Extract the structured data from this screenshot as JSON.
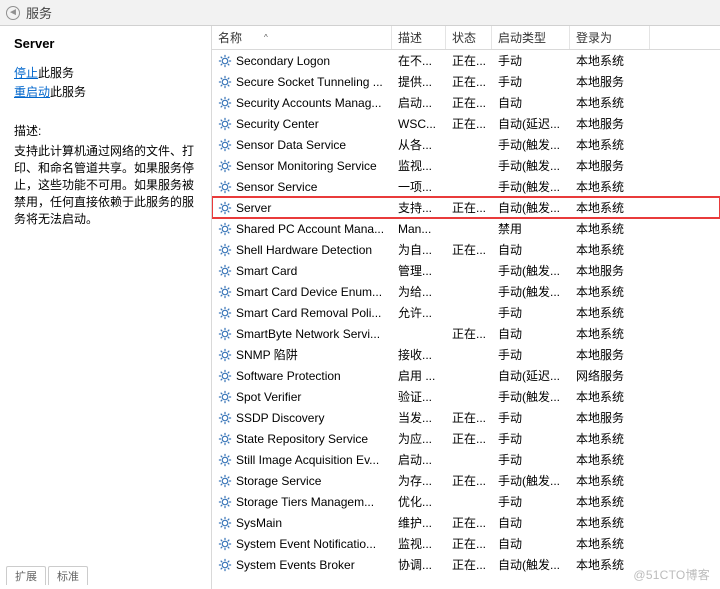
{
  "header": {
    "title": "服务"
  },
  "left": {
    "title": "Server",
    "stop_label": "停止",
    "stop_after": "此服务",
    "restart_label": "重启动",
    "restart_after": "此服务",
    "desc_label": "描述:",
    "desc_text": "支持此计算机通过网络的文件、打印、和命名管道共享。如果服务停止，这些功能不可用。如果服务被禁用，任何直接依赖于此服务的服务将无法启动。"
  },
  "columns": {
    "name": "名称",
    "desc": "描述",
    "state": "状态",
    "startup": "启动类型",
    "logon": "登录为"
  },
  "services": [
    {
      "name": "Secondary Logon",
      "desc": "在不...",
      "state": "正在...",
      "startup": "手动",
      "logon": "本地系统"
    },
    {
      "name": "Secure Socket Tunneling ...",
      "desc": "提供...",
      "state": "正在...",
      "startup": "手动",
      "logon": "本地服务"
    },
    {
      "name": "Security Accounts Manag...",
      "desc": "启动...",
      "state": "正在...",
      "startup": "自动",
      "logon": "本地系统"
    },
    {
      "name": "Security Center",
      "desc": "WSC...",
      "state": "正在...",
      "startup": "自动(延迟...",
      "logon": "本地服务"
    },
    {
      "name": "Sensor Data Service",
      "desc": "从各...",
      "state": "",
      "startup": "手动(触发...",
      "logon": "本地系统"
    },
    {
      "name": "Sensor Monitoring Service",
      "desc": "监视...",
      "state": "",
      "startup": "手动(触发...",
      "logon": "本地服务"
    },
    {
      "name": "Sensor Service",
      "desc": "一项...",
      "state": "",
      "startup": "手动(触发...",
      "logon": "本地系统"
    },
    {
      "name": "Server",
      "desc": "支持...",
      "state": "正在...",
      "startup": "自动(触发...",
      "logon": "本地系统"
    },
    {
      "name": "Shared PC Account Mana...",
      "desc": "Man...",
      "state": "",
      "startup": "禁用",
      "logon": "本地系统"
    },
    {
      "name": "Shell Hardware Detection",
      "desc": "为自...",
      "state": "正在...",
      "startup": "自动",
      "logon": "本地系统"
    },
    {
      "name": "Smart Card",
      "desc": "管理...",
      "state": "",
      "startup": "手动(触发...",
      "logon": "本地服务"
    },
    {
      "name": "Smart Card Device Enum...",
      "desc": "为给...",
      "state": "",
      "startup": "手动(触发...",
      "logon": "本地系统"
    },
    {
      "name": "Smart Card Removal Poli...",
      "desc": "允许...",
      "state": "",
      "startup": "手动",
      "logon": "本地系统"
    },
    {
      "name": "SmartByte Network Servi...",
      "desc": "",
      "state": "正在...",
      "startup": "自动",
      "logon": "本地系统"
    },
    {
      "name": "SNMP 陷阱",
      "desc": "接收...",
      "state": "",
      "startup": "手动",
      "logon": "本地服务"
    },
    {
      "name": "Software Protection",
      "desc": "启用 ...",
      "state": "",
      "startup": "自动(延迟...",
      "logon": "网络服务"
    },
    {
      "name": "Spot Verifier",
      "desc": "验证...",
      "state": "",
      "startup": "手动(触发...",
      "logon": "本地系统"
    },
    {
      "name": "SSDP Discovery",
      "desc": "当发...",
      "state": "正在...",
      "startup": "手动",
      "logon": "本地服务"
    },
    {
      "name": "State Repository Service",
      "desc": "为应...",
      "state": "正在...",
      "startup": "手动",
      "logon": "本地系统"
    },
    {
      "name": "Still Image Acquisition Ev...",
      "desc": "启动...",
      "state": "",
      "startup": "手动",
      "logon": "本地系统"
    },
    {
      "name": "Storage Service",
      "desc": "为存...",
      "state": "正在...",
      "startup": "手动(触发...",
      "logon": "本地系统"
    },
    {
      "name": "Storage Tiers Managem...",
      "desc": "优化...",
      "state": "",
      "startup": "手动",
      "logon": "本地系统"
    },
    {
      "name": "SysMain",
      "desc": "维护...",
      "state": "正在...",
      "startup": "自动",
      "logon": "本地系统"
    },
    {
      "name": "System Event Notificatio...",
      "desc": "监视...",
      "state": "正在...",
      "startup": "自动",
      "logon": "本地系统"
    },
    {
      "name": "System Events Broker",
      "desc": "协调...",
      "state": "正在...",
      "startup": "自动(触发...",
      "logon": "本地系统"
    }
  ],
  "highlight_index": 7,
  "watermark": "@51CTO博客",
  "bottom_tabs": {
    "tab1": "扩展",
    "tab2": "标准"
  }
}
